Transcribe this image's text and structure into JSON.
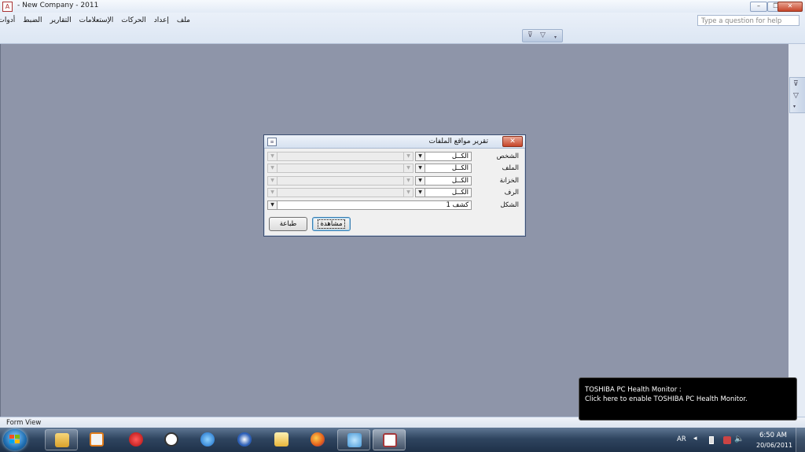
{
  "window": {
    "title": "- New Company - 2011",
    "min": "–",
    "restore": "❐",
    "close": "✕"
  },
  "menu": {
    "items": [
      "ملف",
      "إعداد",
      "الحركات",
      "الإستعلامات",
      "التقارير",
      "الضبط",
      "أدوات"
    ]
  },
  "help": {
    "placeholder": "Type a question for help"
  },
  "dialog": {
    "title": "تقرير مواقع الملفات",
    "close": "✕",
    "rows": [
      {
        "label": "الشخص",
        "value": "الكــل"
      },
      {
        "label": "الملف",
        "value": "الكــل"
      },
      {
        "label": "الخزانة",
        "value": "الكــل"
      },
      {
        "label": "الرف",
        "value": "الكــل"
      }
    ],
    "shape_label": "الشكل",
    "shape_value": "كشف 1",
    "view_button": "مشاهدة",
    "print_button": "طباعة"
  },
  "status": {
    "text": "Form View"
  },
  "balloon": {
    "line1": "TOSHIBA PC Health Monitor :",
    "line2": "Click here to enable TOSHIBA PC Health Monitor."
  },
  "tray": {
    "lang": "AR",
    "time": "6:50 AM",
    "date": "20/06/2011"
  }
}
